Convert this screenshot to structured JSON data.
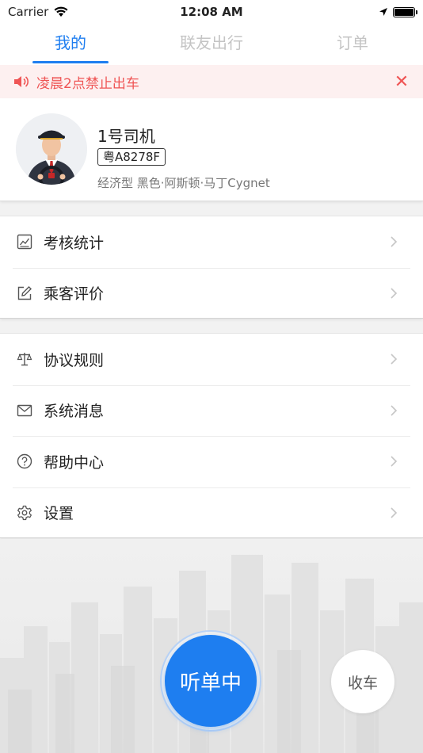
{
  "status_bar": {
    "carrier": "Carrier",
    "time": "12:08 AM"
  },
  "tabs": [
    {
      "label": "我的",
      "active": true
    },
    {
      "label": "联友出行",
      "active": false
    },
    {
      "label": "订单",
      "active": false
    }
  ],
  "notice": {
    "text": "凌晨2点禁止出车",
    "close": "✕"
  },
  "profile": {
    "name": "1号司机",
    "plate": "粤A8278F",
    "vehicle": "经济型 黑色·阿斯顿·马丁Cygnet"
  },
  "menu_group_1": [
    {
      "label": "考核统计",
      "icon": "chart-icon"
    },
    {
      "label": "乘客评价",
      "icon": "edit-icon"
    }
  ],
  "menu_group_2": [
    {
      "label": "协议规则",
      "icon": "scale-icon"
    },
    {
      "label": "系统消息",
      "icon": "mail-icon"
    },
    {
      "label": "帮助中心",
      "icon": "help-icon"
    },
    {
      "label": "设置",
      "icon": "gear-icon"
    }
  ],
  "actions": {
    "listen": "听单中",
    "offline": "收车"
  },
  "colors": {
    "accent": "#1e7ef0",
    "notice": "#ef5555",
    "notice_bg": "#fdf0f0"
  }
}
